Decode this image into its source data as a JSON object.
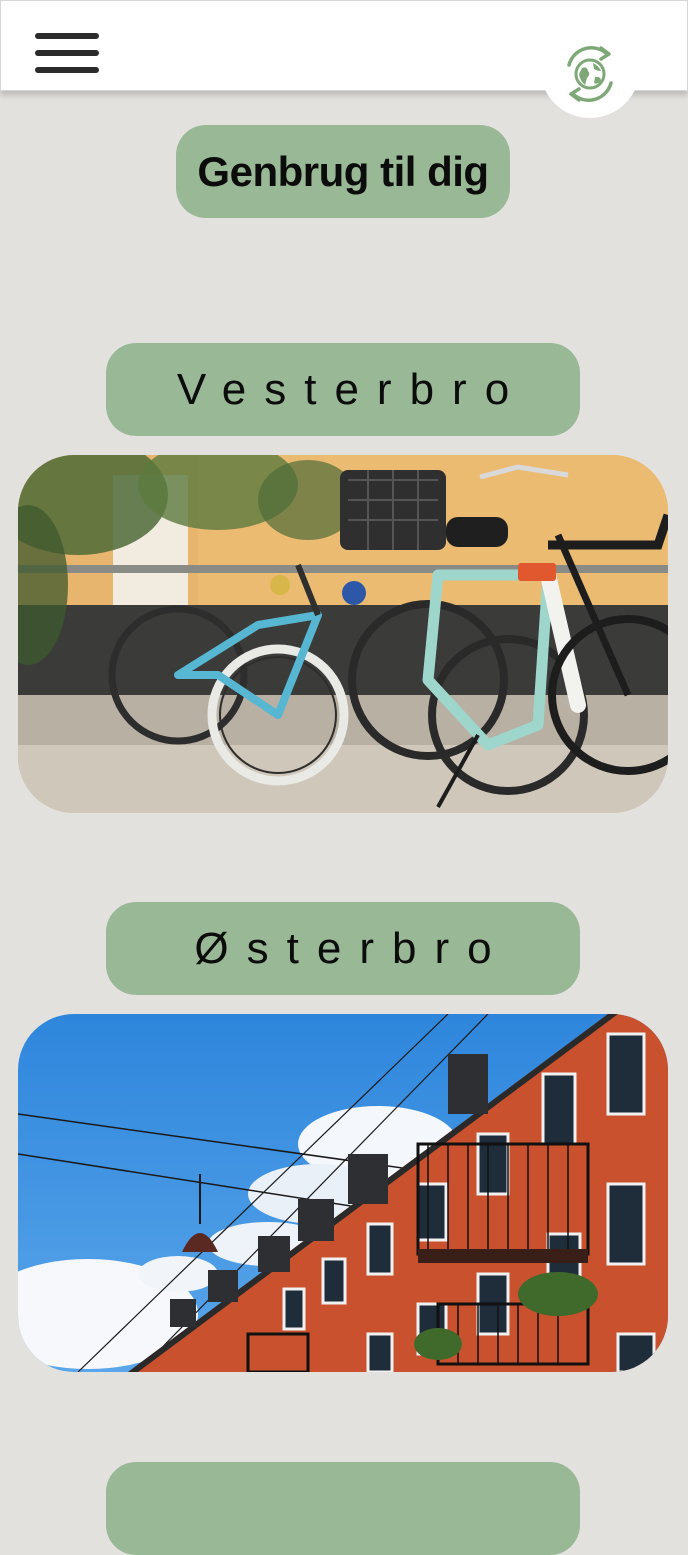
{
  "header": {
    "menu_icon": "hamburger-menu-icon",
    "logo_icon": "recycle-globe-logo-icon"
  },
  "page": {
    "title": "Genbrug til dig"
  },
  "areas": [
    {
      "label": "Vesterbro",
      "image": "bicycles-against-wall-photo"
    },
    {
      "label": "Østerbro",
      "image": "red-brick-apartment-building-photo"
    },
    {
      "label": ""
    }
  ],
  "colors": {
    "background": "#e3e1de",
    "pill_green": "#99b896",
    "logo_green": "#7fa878"
  }
}
